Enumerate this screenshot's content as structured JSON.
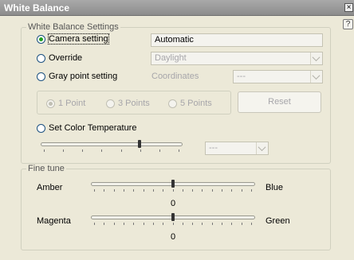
{
  "window": {
    "title": "White Balance",
    "close_glyph": "×",
    "help_glyph": "?"
  },
  "wb_settings": {
    "group_label": "White Balance Settings",
    "camera_setting": {
      "label": "Camera setting",
      "value": "Automatic",
      "checked": true
    },
    "override": {
      "label": "Override",
      "value": "Daylight",
      "checked": false
    },
    "gray_point": {
      "label": "Gray point setting",
      "coords_label": "Coordinates",
      "coords_value": "---",
      "checked": false
    },
    "points": [
      {
        "label": "1 Point",
        "checked": true
      },
      {
        "label": "3 Points",
        "checked": false
      },
      {
        "label": "5 Points",
        "checked": false
      }
    ],
    "reset_label": "Reset",
    "color_temp": {
      "label": "Set Color Temperature",
      "value": "---",
      "checked": false,
      "slider_fraction": 0.7
    }
  },
  "fine_tune": {
    "group_label": "Fine tune",
    "amber_blue": {
      "left_label": "Amber",
      "right_label": "Blue",
      "value": "0",
      "fraction": 0.5
    },
    "magenta_green": {
      "left_label": "Magenta",
      "right_label": "Green",
      "value": "0",
      "fraction": 0.5
    }
  }
}
